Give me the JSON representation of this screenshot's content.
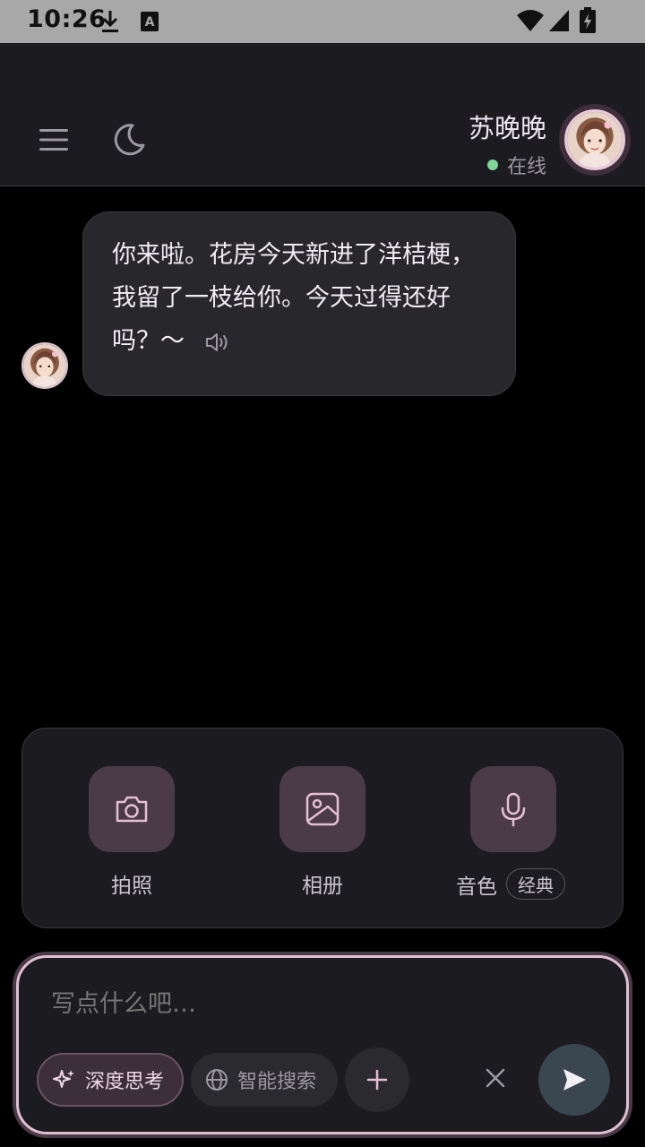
{
  "status_bar": {
    "time": "10:26"
  },
  "header": {
    "persona_name": "苏晚晚",
    "persona_status": "在线"
  },
  "chat": {
    "messages": [
      {
        "role": "assistant",
        "text": "你来啦。花房今天新进了洋桔梗，我留了一枝给你。今天过得还好吗？～"
      }
    ]
  },
  "attach_panel": {
    "camera_label": "拍照",
    "album_label": "相册",
    "voice_label": "音色",
    "voice_value": "经典"
  },
  "composer": {
    "placeholder": "写点什么吧…",
    "deep_think_label": "深度思考",
    "smart_search_label": "智能搜索"
  },
  "colors": {
    "accent": "#e0bfd2",
    "online": "#7fd59a",
    "tool_bg": "#4a3b46"
  }
}
